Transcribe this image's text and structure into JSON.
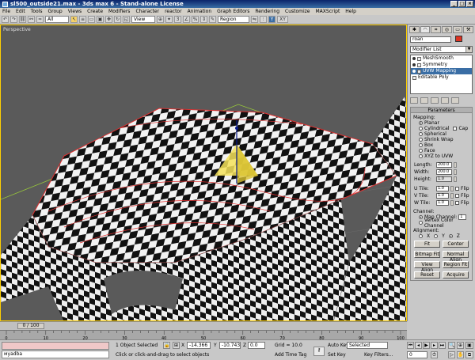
{
  "window": {
    "title": "sl500_outside21.max - 3ds max 6 - Stand-alone License"
  },
  "menu": [
    "File",
    "Edit",
    "Tools",
    "Group",
    "Views",
    "Create",
    "Modifiers",
    "Character",
    "reactor",
    "Animation",
    "Graph Editors",
    "Rendering",
    "Customize",
    "MAXScript",
    "Help"
  ],
  "toolbar": {
    "selection_filter": "All",
    "reference_coord": "View",
    "named_selection": "Region",
    "axis_y": "Y",
    "axis_xy": "XY"
  },
  "viewport": {
    "label": "Perspective"
  },
  "command_panel": {
    "object_name": "roan",
    "modifier_list": "Modifier List",
    "stack": [
      "MeshSmooth",
      "Symmetry",
      "UVW Mapping",
      "Editable Poly"
    ],
    "selected_stack_index": 2,
    "rollout_title": "Parameters",
    "mapping_section": "Mapping:",
    "mapping_options": [
      "Planar",
      "Cylindrical",
      "Spherical",
      "Shrink Wrap",
      "Box",
      "Face",
      "XYZ to UVW"
    ],
    "mapping_selected": "Planar",
    "cap_label": "Cap",
    "length_label": "Length:",
    "length_value": "200.0",
    "width_label": "Width:",
    "width_value": "200.0",
    "height_label": "Height:",
    "height_value": "1.0",
    "utile_label": "U Tile:",
    "utile_value": "1.0",
    "vtile_label": "V Tile:",
    "vtile_value": "1.0",
    "wtile_label": "W Tile:",
    "wtile_value": "1.0",
    "flip_label": "Flip",
    "channel_section": "Channel:",
    "map_channel_label": "Map Channel:",
    "map_channel_value": "1",
    "vertex_color_label": "Vertex Color Channel",
    "alignment_section": "Alignment:",
    "align_x": "X",
    "align_y": "Y",
    "align_z": "Z",
    "fit_btn": "Fit",
    "center_btn": "Center",
    "bitmap_fit_btn": "Bitmap Fit",
    "normal_align_btn": "Normal Align",
    "view_align_btn": "View Align",
    "region_fit_btn": "Region Fit",
    "reset_btn": "Reset",
    "acquire_btn": "Acquire"
  },
  "timeline": {
    "slider": "0 / 100",
    "ticks": [
      "0",
      "10",
      "20",
      "30",
      "40",
      "50",
      "60",
      "70",
      "80",
      "90",
      "100"
    ]
  },
  "status": {
    "maxscript_text": "мyadba",
    "selection": "1 Object Selected",
    "prompt": "Click or click-and-drag to select objects",
    "x_label": "X",
    "x_value": "-14.366",
    "y_label": "Y",
    "y_value": "-10.743",
    "z_label": "Z",
    "z_value": "0.0",
    "grid": "Grid = 10.0",
    "add_time_tag": "Add Time Tag",
    "auto_key": "Auto Key",
    "set_key": "Set Key",
    "selected_drop": "Selected",
    "key_filters": "Key Filters...",
    "frame": "0"
  },
  "colors": {
    "viewport_bg": "#5a5a5a",
    "selection_red": "#e03030",
    "active_border": "#ffd000",
    "title_blue": "#0a246a"
  }
}
